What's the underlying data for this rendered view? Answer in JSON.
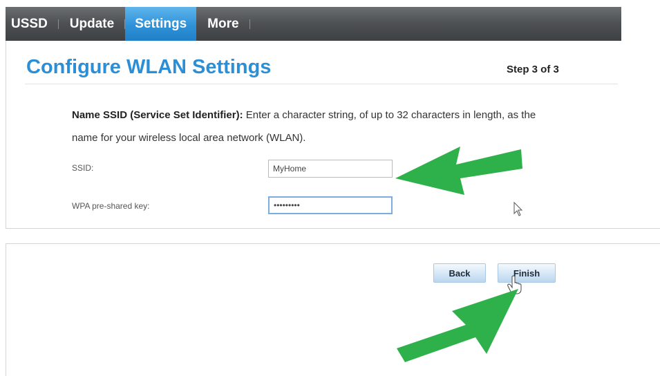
{
  "nav": {
    "tabs": [
      {
        "label": "USSD"
      },
      {
        "label": "Update"
      },
      {
        "label": "Settings",
        "active": true
      },
      {
        "label": "More"
      }
    ]
  },
  "page": {
    "title": "Configure WLAN Settings",
    "step": "Step 3 of 3"
  },
  "description": {
    "bold": "Name SSID (Service Set Identifier):",
    "text": " Enter a character string, of up to 32 characters in length, as the name for your wireless local area network (WLAN)."
  },
  "form": {
    "ssid_label": "SSID:",
    "ssid_value": "MyHome",
    "key_label": "WPA pre-shared key:",
    "key_value": "•••••••••"
  },
  "buttons": {
    "back": "Back",
    "finish": "Finish"
  },
  "colors": {
    "accent": "#2c8fd6",
    "nav_bg": "#4d5053",
    "annotation_arrow": "#2eb04a"
  },
  "icons": [
    "arrow-pointer-cursor-icon",
    "hand-pointer-cursor-icon",
    "annotation-arrow-icon"
  ]
}
